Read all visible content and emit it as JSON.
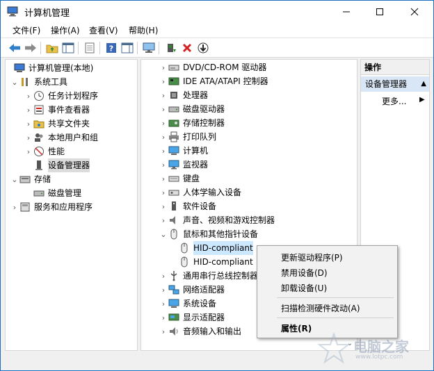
{
  "window": {
    "title": "计算机管理"
  },
  "menubar": [
    "文件(F)",
    "操作(A)",
    "查看(V)",
    "帮助(H)"
  ],
  "toolbar": {
    "buttons": [
      "back-icon",
      "forward-icon",
      "up-folder-icon",
      "show-tree-icon",
      "export-list-icon",
      "help-icon",
      "properties-pane-icon",
      "computer-monitor-icon",
      "update-driver-icon",
      "uninstall-icon",
      "download-icon"
    ]
  },
  "left_tree": [
    {
      "label": "计算机管理(本地)",
      "level": 0,
      "expander": "",
      "icon": "computer-management-icon"
    },
    {
      "label": "系统工具",
      "level": 1,
      "expander": "⌄",
      "icon": "tools-icon"
    },
    {
      "label": "任务计划程序",
      "level": 2,
      "expander": "›",
      "icon": "clock-icon"
    },
    {
      "label": "事件查看器",
      "level": 2,
      "expander": "›",
      "icon": "event-viewer-icon"
    },
    {
      "label": "共享文件夹",
      "level": 2,
      "expander": "›",
      "icon": "shared-folder-icon"
    },
    {
      "label": "本地用户和组",
      "level": 2,
      "expander": "›",
      "icon": "users-icon"
    },
    {
      "label": "性能",
      "level": 2,
      "expander": "›",
      "icon": "performance-icon"
    },
    {
      "label": "设备管理器",
      "level": 2,
      "expander": "",
      "icon": "device-manager-icon",
      "selected": true
    },
    {
      "label": "存储",
      "level": 1,
      "expander": "⌄",
      "icon": "storage-icon"
    },
    {
      "label": "磁盘管理",
      "level": 2,
      "expander": "",
      "icon": "disk-management-icon"
    },
    {
      "label": "服务和应用程序",
      "level": 1,
      "expander": "›",
      "icon": "services-icon"
    }
  ],
  "devices": [
    {
      "label": "DVD/CD-ROM 驱动器",
      "expander": "›",
      "icon": "dvd-icon"
    },
    {
      "label": "IDE ATA/ATAPI 控制器",
      "expander": "›",
      "icon": "ide-controller-icon"
    },
    {
      "label": "处理器",
      "expander": "›",
      "icon": "processor-icon"
    },
    {
      "label": "磁盘驱动器",
      "expander": "›",
      "icon": "disk-drive-icon"
    },
    {
      "label": "存储控制器",
      "expander": "›",
      "icon": "storage-controller-icon"
    },
    {
      "label": "打印队列",
      "expander": "›",
      "icon": "printer-icon"
    },
    {
      "label": "计算机",
      "expander": "›",
      "icon": "computer-icon"
    },
    {
      "label": "监视器",
      "expander": "›",
      "icon": "monitor-icon"
    },
    {
      "label": "键盘",
      "expander": "›",
      "icon": "keyboard-icon"
    },
    {
      "label": "人体学输入设备",
      "expander": "›",
      "icon": "hid-icon"
    },
    {
      "label": "软件设备",
      "expander": "›",
      "icon": "software-device-icon"
    },
    {
      "label": "声音、视频和游戏控制器",
      "expander": "›",
      "icon": "audio-icon"
    },
    {
      "label": "鼠标和其他指针设备",
      "expander": "⌄",
      "icon": "mouse-icon"
    },
    {
      "label": "HID-compliant",
      "expander": "",
      "icon": "mouse-icon",
      "child": true,
      "selected": true
    },
    {
      "label": "HID-compliant",
      "expander": "",
      "icon": "mouse-icon",
      "child": true
    },
    {
      "label": "通用串行总线控制器",
      "expander": "›",
      "icon": "usb-icon"
    },
    {
      "label": "网络适配器",
      "expander": "›",
      "icon": "network-icon"
    },
    {
      "label": "系统设备",
      "expander": "›",
      "icon": "system-device-icon"
    },
    {
      "label": "显示适配器",
      "expander": "›",
      "icon": "display-adapter-icon"
    },
    {
      "label": "音频输入和输出",
      "expander": "›",
      "icon": "audio-io-icon"
    }
  ],
  "actions": {
    "header": "操作",
    "section": "设备管理器",
    "more": "更多..."
  },
  "context_menu": {
    "items": [
      "更新驱动程序(P)",
      "禁用设备(D)",
      "卸载设备(U)",
      "扫描检测硬件改动(A)",
      "属性(R)"
    ]
  },
  "watermark": {
    "text": "电脑之家",
    "url": "www.lotpc.com"
  }
}
